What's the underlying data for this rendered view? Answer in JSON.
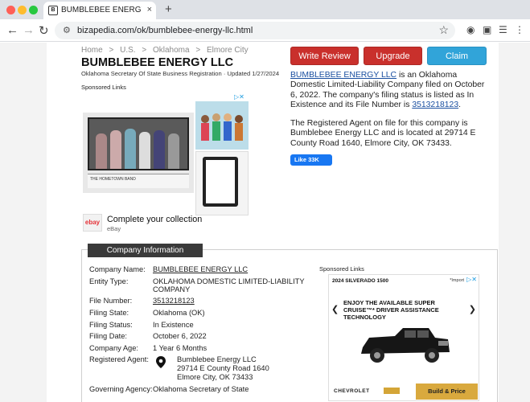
{
  "browser": {
    "tab_title": "BUMBLEBEE ENERGY LLC in",
    "tab_close": "×",
    "new_tab": "+",
    "url": "bizapedia.com/ok/bumblebee-energy-llc.html"
  },
  "breadcrumb": [
    "Home",
    "U.S.",
    "Oklahoma",
    "Elmore City"
  ],
  "breadcrumb_sep": ">",
  "header": {
    "title": "BUMBLEBEE ENERGY LLC",
    "subtitle": "Oklahoma Secretary Of State Business Registration · Updated 1/27/2024"
  },
  "actions": {
    "write_review": "Write Review",
    "upgrade": "Upgrade",
    "claim": "Claim"
  },
  "description": {
    "p1_link": "BUMBLEBEE ENERGY LLC",
    "p1_text": " is an Oklahoma Domestic Limited-Liability Company filed on October 6, 2022. The company's filing status is listed as In Existence and its File Number is ",
    "p1_file_link": "3513218123",
    "p1_end": ".",
    "p2_text": "The Registered Agent on file for this company is Bumblebee Energy LLC and is located at 29714 E County Road 1640, Elmore City, OK 73433."
  },
  "like": {
    "label": "Like 33K"
  },
  "sponsored_label": "Sponsored Links",
  "ad1": {
    "caption": "THE HOMETOWN BAND",
    "logo": "ebay",
    "headline": "Complete your collection",
    "source": "eBay"
  },
  "company_info": {
    "header": "Company Information",
    "rows": [
      {
        "label": "Company Name:",
        "value": "BUMBLEBEE ENERGY LLC"
      },
      {
        "label": "Entity Type:",
        "value": "OKLAHOMA DOMESTIC LIMITED-LIABILITY"
      },
      {
        "label": "",
        "value": "COMPANY"
      },
      {
        "label": "File Number:",
        "value": "3513218123"
      },
      {
        "label": "Filing State:",
        "value": "Oklahoma (OK)"
      },
      {
        "label": "Filing Status:",
        "value": "In Existence"
      },
      {
        "label": "Filing Date:",
        "value": "October 6, 2022"
      },
      {
        "label": "Company Age:",
        "value": "1 Year 6 Months"
      },
      {
        "label": "Registered Agent:",
        "value": ""
      },
      {
        "label": "Governing Agency:",
        "value": "Oklahoma Secretary of State"
      }
    ],
    "agent_lines": [
      "Bumblebee Energy LLC",
      "29714 E County Road 1640",
      "Elmore City, OK 73433"
    ]
  },
  "ad2": {
    "topline": "2024 SILVERADO 1500",
    "import_note": "*Import",
    "headline": "ENJOY THE AVAILABLE SUPER CRUISE™* DRIVER ASSISTANCE TECHNOLOGY",
    "brand": "CHEVROLET",
    "cta": "Build & Price"
  },
  "colors": {
    "review_red": "#c9302c",
    "claim_blue": "#31a4d9",
    "facebook_blue": "#1877f2",
    "link_blue": "#1a4fa0"
  }
}
